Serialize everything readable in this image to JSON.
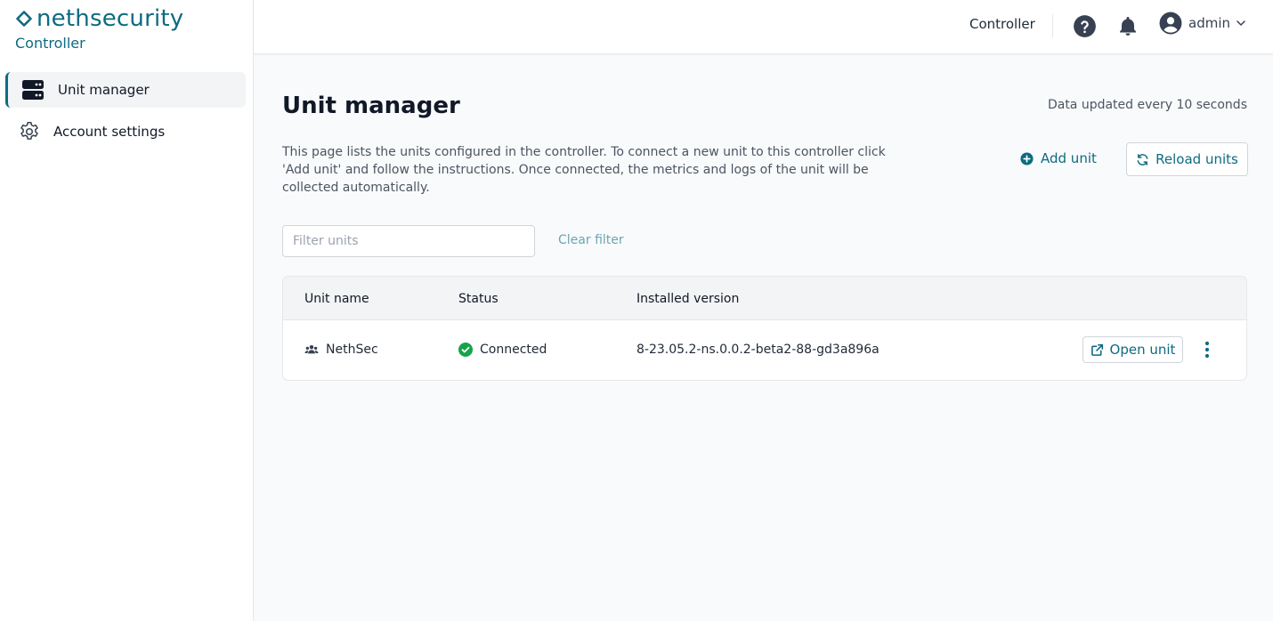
{
  "brand": {
    "name": "nethsecurity",
    "subtitle": "Controller",
    "accent_color": "#0e6b80"
  },
  "sidebar": {
    "items": [
      {
        "label": "Unit manager",
        "icon": "server-icon",
        "active": true
      },
      {
        "label": "Account settings",
        "icon": "gear-icon",
        "active": false
      }
    ]
  },
  "topbar": {
    "controller_label": "Controller",
    "help_icon": "question-circle-icon",
    "notifications_icon": "bell-icon",
    "user": {
      "name": "admin",
      "avatar_icon": "user-circle-icon"
    }
  },
  "main": {
    "title": "Unit manager",
    "update_notice": "Data updated every 10 seconds",
    "description": "This page lists the units configured in the controller. To connect a new unit to this controller click 'Add unit' and follow the instructions. Once connected, the metrics and logs of the unit will be collected automatically.",
    "add_unit_label": "Add unit",
    "reload_units_label": "Reload units",
    "filter": {
      "placeholder": "Filter units",
      "value": ""
    },
    "clear_filter_label": "Clear filter"
  },
  "table": {
    "columns": [
      "Unit name",
      "Status",
      "Installed version"
    ],
    "rows": [
      {
        "unit_name": "NethSec",
        "status": "Connected",
        "status_color": "#16a34a",
        "installed_version": "8-23.05.2-ns.0.0.2-beta2-88-gd3a896a",
        "open_label": "Open unit"
      }
    ]
  }
}
